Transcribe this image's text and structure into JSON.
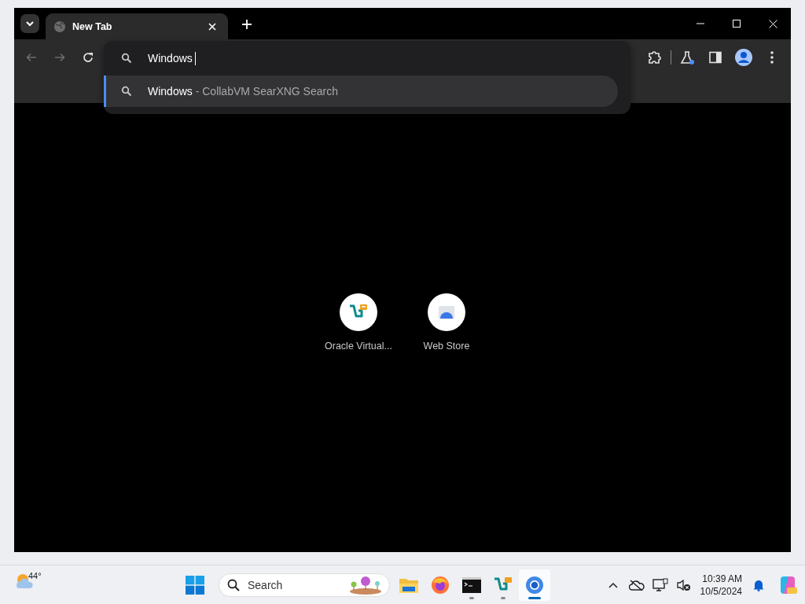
{
  "tabs": [
    {
      "title": "New Tab",
      "selected": true
    }
  ],
  "nav_buttons": [
    {
      "kind": "back",
      "disabled": true
    },
    {
      "kind": "forward",
      "disabled": true
    },
    {
      "kind": "reload",
      "disabled": false
    }
  ],
  "omnibox": {
    "value": "Windows"
  },
  "suggestions": [
    {
      "match": "Windows",
      "source": "- CollabVM SearXNG Search",
      "selected": true
    }
  ],
  "shortcuts": [
    {
      "label": "Oracle Virtual...",
      "kind": "vbox"
    },
    {
      "label": "Web Store",
      "kind": "store"
    }
  ],
  "taskbar": {
    "temperature": "44°",
    "search_placeholder": "Search",
    "time": "10:39 AM",
    "date": "10/5/2024",
    "apps": [
      {
        "kind": "folder",
        "running": false,
        "active": false
      },
      {
        "kind": "firefox",
        "running": false,
        "active": false
      },
      {
        "kind": "terminal",
        "running": true,
        "active": false
      },
      {
        "kind": "vbox",
        "running": true,
        "active": false
      },
      {
        "kind": "chrome",
        "running": true,
        "active": true
      }
    ]
  }
}
